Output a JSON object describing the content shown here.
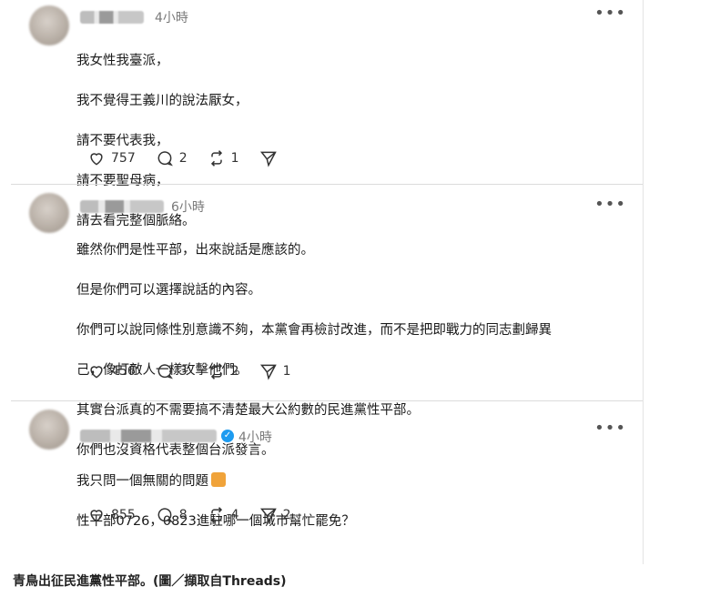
{
  "posts": [
    {
      "time": "4小時",
      "lines": [
        "我女性我臺派，",
        "我不覺得王義川的說法厭女，",
        "請不要代表我，",
        "請不要聖母病，",
        "請去看完整個脈絡。"
      ],
      "likes": "757",
      "replies": "2",
      "reposts": "1",
      "shares": ""
    },
    {
      "time": "6小時",
      "lines": [
        "雖然你們是性平部，出來說話是應該的。",
        "但是你們可以選擇說話的內容。",
        "你們可以說同條性別意識不夠，本黨會再檢討改進，而不是把即戰力的同志劃歸異",
        "己，像打敵人一樣攻擊他們。",
        "其實台派真的不需要搞不清楚最大公約數的民進黨性平部。",
        "你們也沒資格代表整個台派發言。"
      ],
      "likes": "456",
      "replies": "3",
      "reposts": "2",
      "shares": "1"
    },
    {
      "time": "4小時",
      "lines": [
        "我只問一個無關的問題",
        "性平部0726，0823進駐哪一個城市幫忙罷免？"
      ],
      "likes": "855",
      "replies": "8",
      "reposts": "4",
      "shares": "2"
    }
  ],
  "caption": "青鳥出征民進黨性平部。(圖／擷取自Threads)",
  "colors": {
    "verified": "#1d9bf0",
    "divider": "#dcdcdc"
  },
  "icons": [
    "heart-icon",
    "comment-icon",
    "repost-icon",
    "send-icon",
    "more-icon",
    "verified-icon"
  ]
}
